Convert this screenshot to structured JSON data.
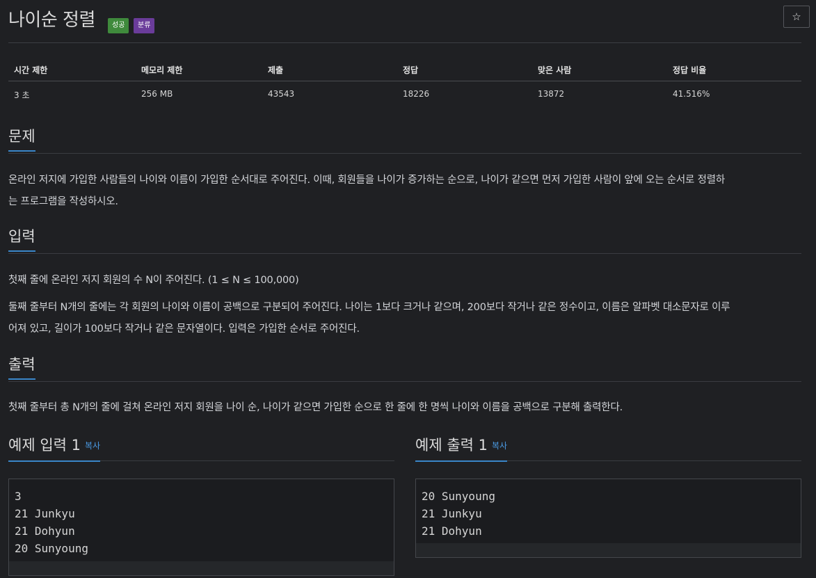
{
  "problem": {
    "title": "나이순 정렬",
    "badges": {
      "success": "성공",
      "category": "분류"
    },
    "star": "☆"
  },
  "stats": {
    "headers": [
      "시간 제한",
      "메모리 제한",
      "제출",
      "정답",
      "맞은 사람",
      "정답 비율"
    ],
    "values": [
      "3 초",
      "256 MB",
      "43543",
      "18226",
      "13872",
      "41.516%"
    ]
  },
  "sections": {
    "description": {
      "heading": "문제",
      "lines": [
        "온라인 저지에 가입한 사람들의 나이와 이름이 가입한 순서대로 주어진다. 이때, 회원들을 나이가 증가하는 순으로, 나이가 같으면 먼저 가입한 사람이 앞에 오는 순서로 정렬하",
        "는 프로그램을 작성하시오."
      ]
    },
    "input": {
      "heading": "입력",
      "para1": "첫째 줄에 온라인 저지 회원의 수 N이 주어진다. (1 ≤ N ≤ 100,000)",
      "para2_lines": [
        "둘째 줄부터 N개의 줄에는 각 회원의 나이와 이름이 공백으로 구분되어 주어진다. 나이는 1보다 크거나 같으며, 200보다 작거나 같은 정수이고, 이름은 알파벳 대소문자로 이루",
        "어져 있고, 길이가 100보다 작거나 같은 문자열이다. 입력은 가입한 순서로 주어진다."
      ]
    },
    "output": {
      "heading": "출력",
      "para": "첫째 줄부터 총 N개의 줄에 걸쳐 온라인 저지 회원을 나이 순, 나이가 같으면 가입한 순으로 한 줄에 한 명씩 나이와 이름을 공백으로 구분해 출력한다."
    }
  },
  "samples": {
    "input": {
      "heading": "예제 입력 1",
      "copy": "복사",
      "lines": [
        "3",
        "21 Junkyu",
        "21 Dohyun",
        "20 Sunyoung"
      ]
    },
    "output": {
      "heading": "예제 출력 1",
      "copy": "복사",
      "lines": [
        "20 Sunyoung",
        "21 Junkyu",
        "21 Dohyun"
      ]
    }
  }
}
